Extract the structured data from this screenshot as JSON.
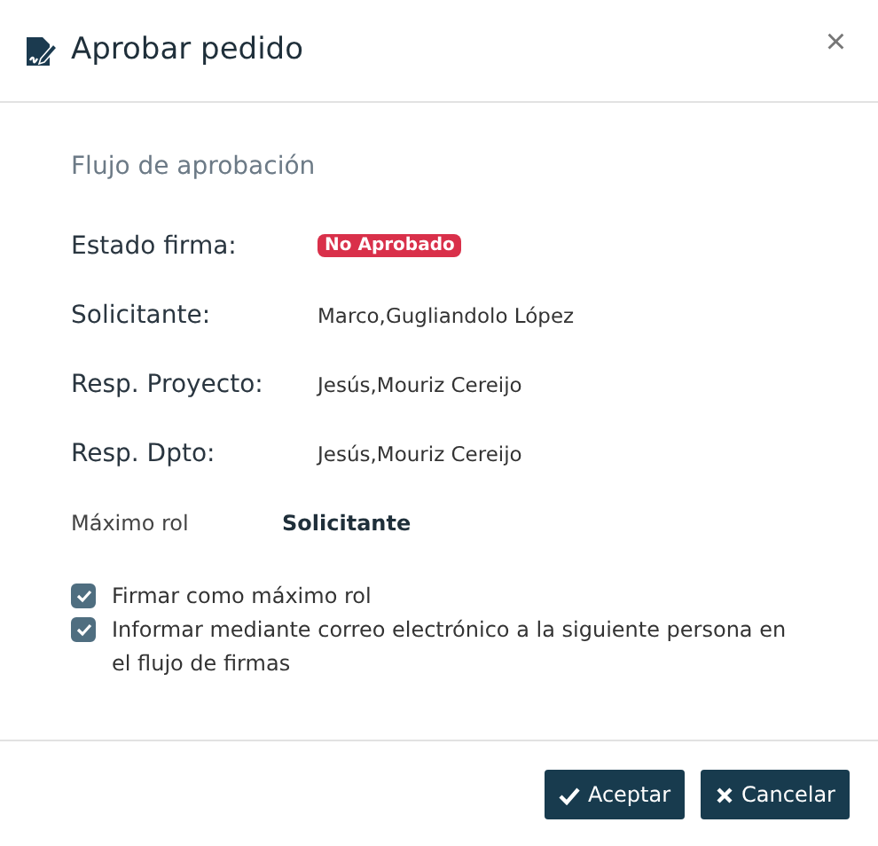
{
  "dialog": {
    "title": "Aprobar pedido",
    "close": "×"
  },
  "section_title": "Flujo de aprobación",
  "fields": [
    {
      "label": "Estado firma:",
      "kind": "badge",
      "value": "No Aprobado",
      "color": "#d9304a"
    },
    {
      "label": "Solicitante:",
      "kind": "text",
      "value": "Marco,Gugliandolo López"
    },
    {
      "label": "Resp. Proyecto:",
      "kind": "text",
      "value": "Jesús,Mouriz Cereijo"
    },
    {
      "label": "Resp. Dpto:",
      "kind": "text",
      "value": "Jesús,Mouriz Cereijo"
    }
  ],
  "max_role": {
    "label": "Máximo rol",
    "value": "Solicitante"
  },
  "options": [
    {
      "label": "Firmar como máximo rol",
      "checked": true
    },
    {
      "label": "Informar mediante correo electrónico a la siguiente persona en el flujo de firmas",
      "checked": true
    }
  ],
  "buttons": [
    {
      "label": "Aceptar",
      "kind": "accept"
    },
    {
      "label": "Cancelar",
      "kind": "cancel"
    }
  ]
}
